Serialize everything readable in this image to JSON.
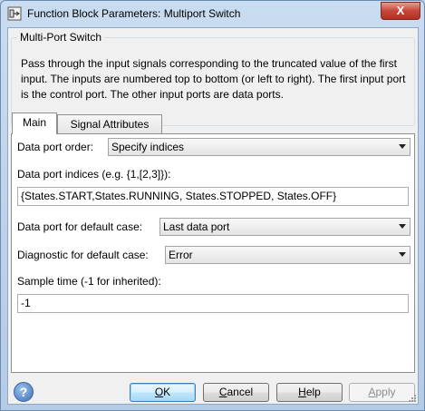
{
  "window": {
    "title": "Function Block Parameters: Multiport Switch",
    "close_label": "X"
  },
  "block": {
    "name": "Multi-Port Switch",
    "description": "Pass through the input signals corresponding to the truncated value of the first input. The inputs are numbered top to bottom (or left to right). The first input port is the control port. The other input ports are data ports."
  },
  "tabs": [
    {
      "label": "Main",
      "active": true
    },
    {
      "label": "Signal Attributes",
      "active": false
    }
  ],
  "main": {
    "data_port_order": {
      "label": "Data port order:",
      "value": "Specify indices"
    },
    "data_port_indices": {
      "label": "Data port indices (e.g. {1,[2,3]}):",
      "value": "{States.START,States.RUNNING, States.STOPPED, States.OFF}"
    },
    "default_case_port": {
      "label": "Data port for default case:",
      "value": "Last data port"
    },
    "diagnostic": {
      "label": "Diagnostic for default case:",
      "value": "Error"
    },
    "sample_time": {
      "label": "Sample time (-1 for inherited):",
      "value": "-1"
    }
  },
  "buttons": {
    "help_icon": "?",
    "ok": {
      "mnemonic": "O",
      "rest": "K"
    },
    "cancel": {
      "mnemonic": "C",
      "rest": "ancel"
    },
    "help": {
      "mnemonic": "H",
      "rest": "elp"
    },
    "apply": {
      "mnemonic": "A",
      "rest": "pply"
    }
  },
  "colors": {
    "title_bar": "#c9dcf0",
    "close_button": "#c7463a",
    "panel": "#f0f0f0",
    "default_button": "#bee6fd"
  }
}
